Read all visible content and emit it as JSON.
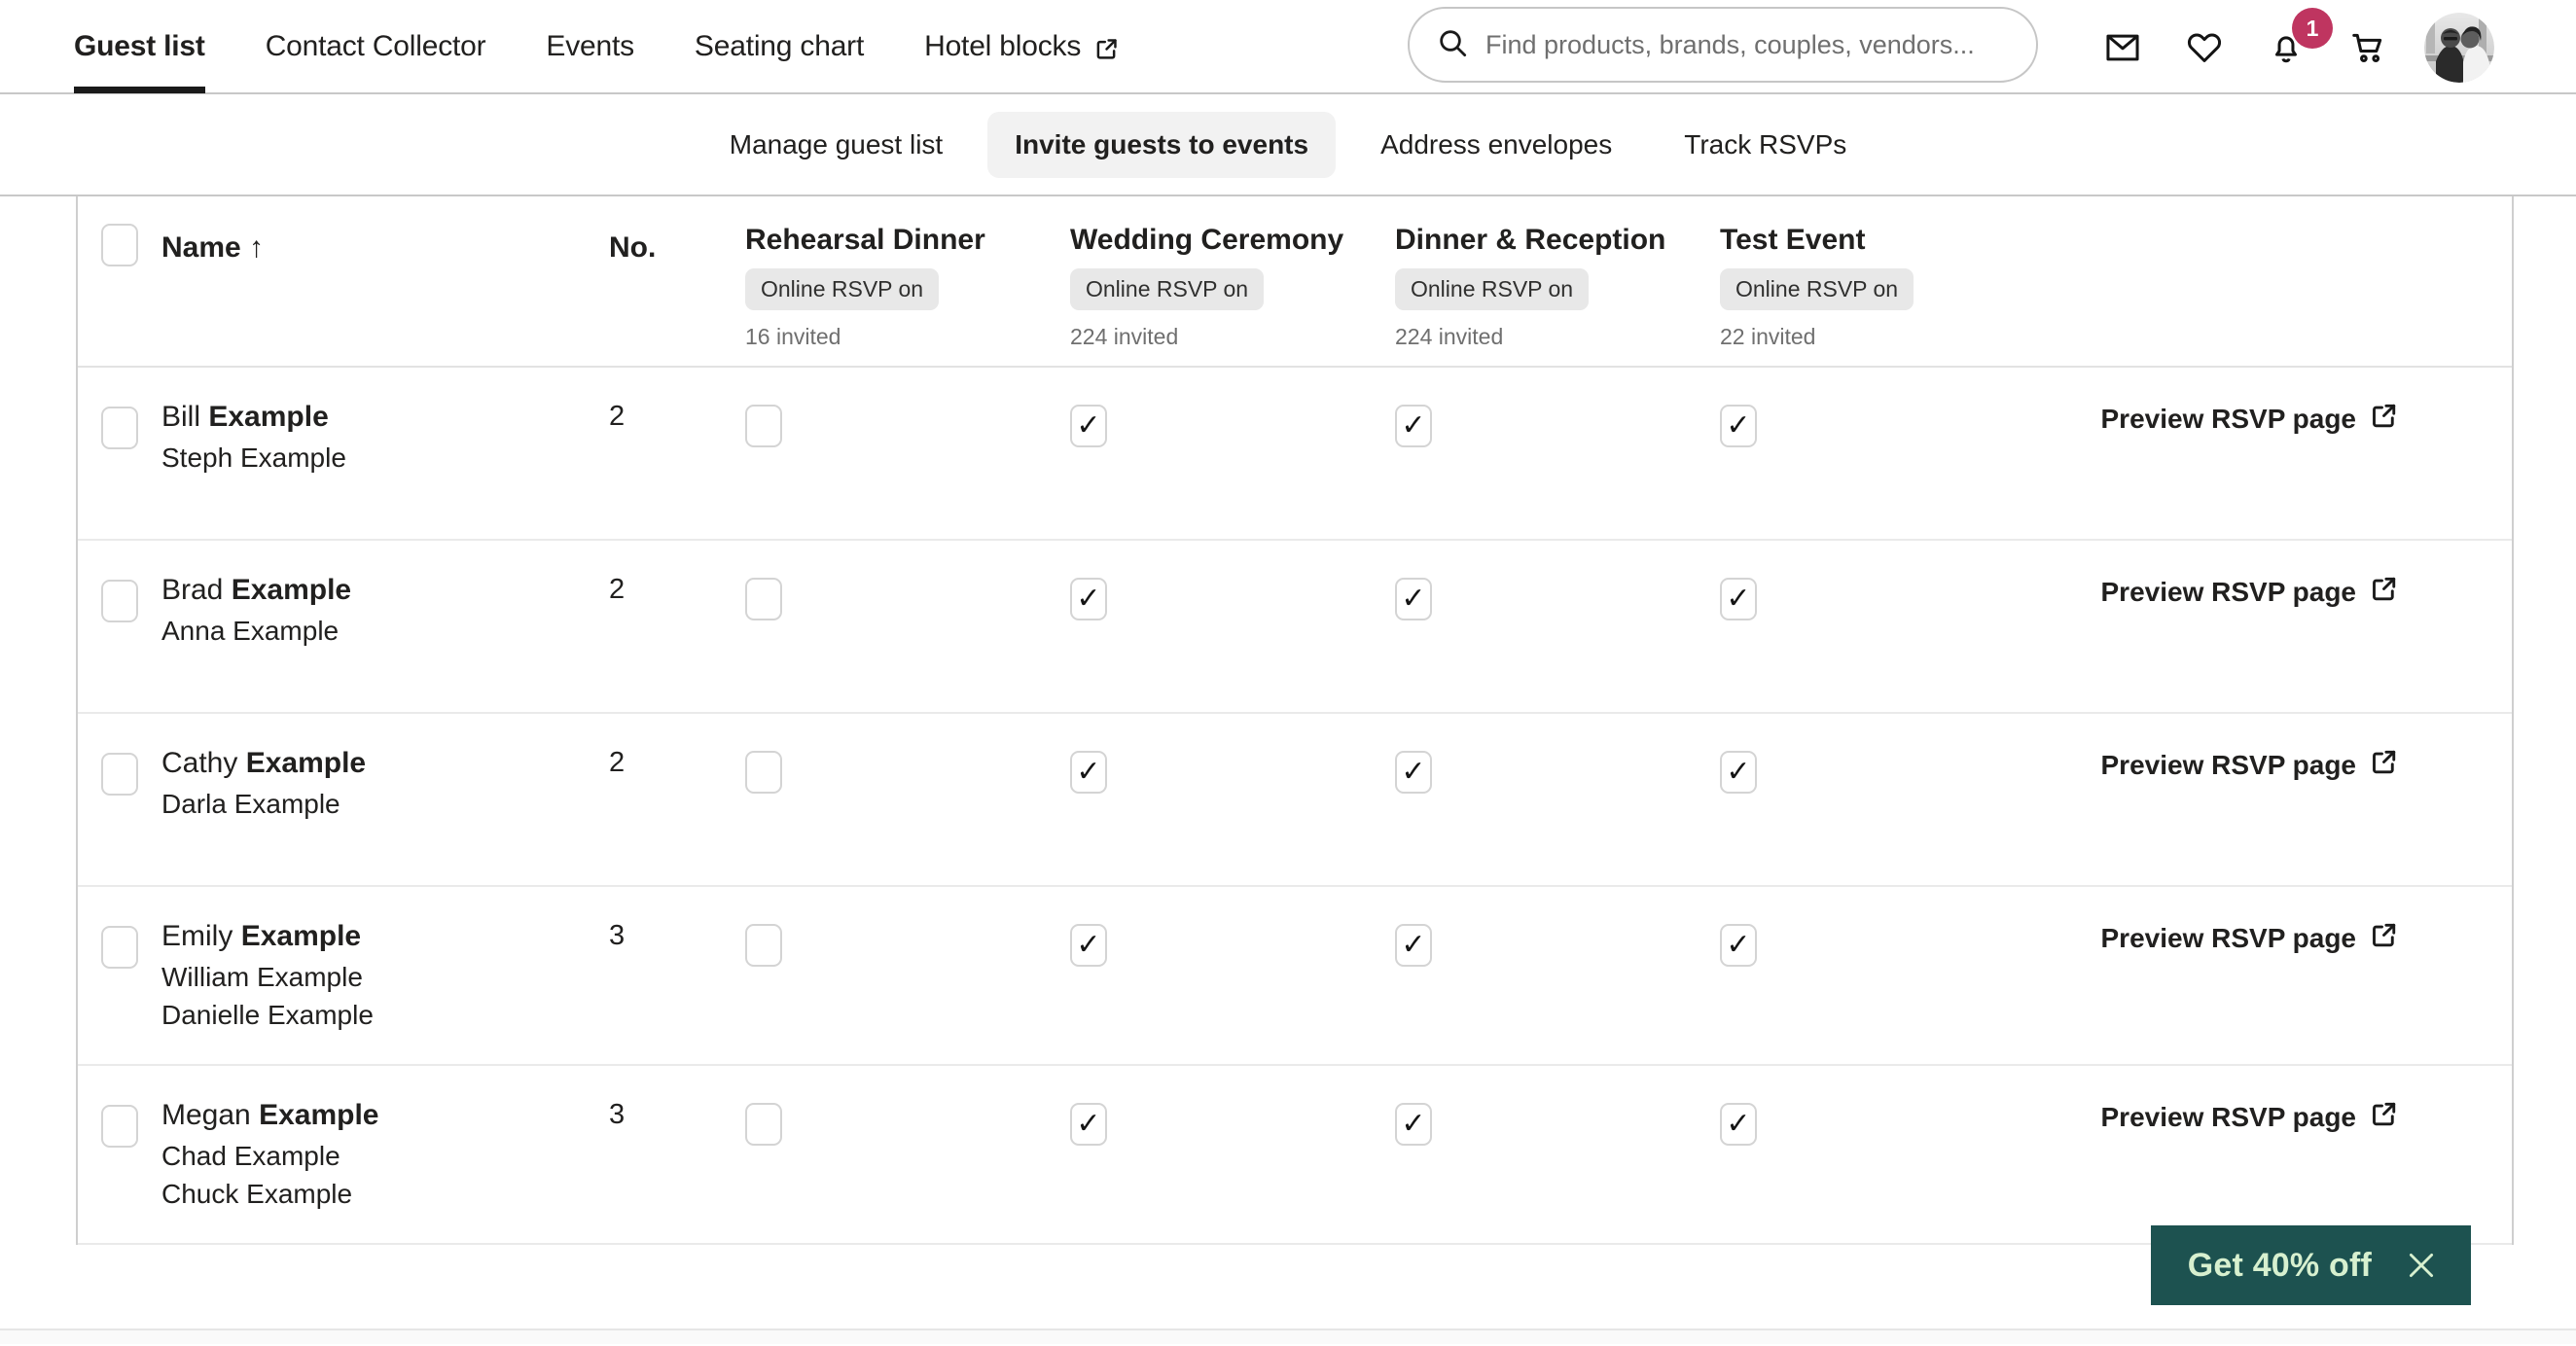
{
  "topnav": {
    "items": [
      {
        "label": "Guest list",
        "active": true,
        "external": false
      },
      {
        "label": "Contact Collector",
        "active": false,
        "external": false
      },
      {
        "label": "Events",
        "active": false,
        "external": false
      },
      {
        "label": "Seating chart",
        "active": false,
        "external": false
      },
      {
        "label": "Hotel blocks",
        "active": false,
        "external": true
      }
    ],
    "search": {
      "value": "",
      "placeholder": "Find products, brands, couples, vendors..."
    },
    "icons": [
      {
        "name": "mail-icon",
        "badge": null
      },
      {
        "name": "heart-icon",
        "badge": null
      },
      {
        "name": "bell-icon",
        "badge": "1"
      },
      {
        "name": "cart-icon",
        "badge": null
      }
    ],
    "badge_color": "#bf3560",
    "avatar_alt": "couple photo"
  },
  "subnav": {
    "items": [
      {
        "label": "Manage guest list",
        "active": false
      },
      {
        "label": "Invite guests to events",
        "active": true
      },
      {
        "label": "Address envelopes",
        "active": false
      },
      {
        "label": "Track RSVPs",
        "active": false
      }
    ]
  },
  "table": {
    "headers": {
      "name": "Name ↑",
      "no": "No.",
      "preview": ""
    },
    "events": [
      {
        "title": "Rehearsal Dinner",
        "rsvp_pill": "Online RSVP on",
        "invited": "16 invited"
      },
      {
        "title": "Wedding Ceremony",
        "rsvp_pill": "Online RSVP on",
        "invited": "224 invited"
      },
      {
        "title": "Dinner & Reception",
        "rsvp_pill": "Online RSVP on",
        "invited": "224 invited"
      },
      {
        "title": "Test Event",
        "rsvp_pill": "Online RSVP on",
        "invited": "22 invited"
      }
    ],
    "preview_label": "Preview RSVP page",
    "rows": [
      {
        "selected": false,
        "first_name": "Bill",
        "last_name": "Example",
        "extra": [
          "Steph Example"
        ],
        "no": "2",
        "checks": [
          false,
          true,
          true,
          true
        ],
        "preview": "Preview RSVP page"
      },
      {
        "selected": false,
        "first_name": "Brad",
        "last_name": "Example",
        "extra": [
          "Anna Example"
        ],
        "no": "2",
        "checks": [
          false,
          true,
          true,
          true
        ],
        "preview": "Preview RSVP page"
      },
      {
        "selected": false,
        "first_name": "Cathy",
        "last_name": "Example",
        "extra": [
          "Darla Example"
        ],
        "no": "2",
        "checks": [
          false,
          true,
          true,
          true
        ],
        "preview": "Preview RSVP page"
      },
      {
        "selected": false,
        "first_name": "Emily",
        "last_name": "Example",
        "extra": [
          "William Example",
          "Danielle Example"
        ],
        "no": "3",
        "checks": [
          false,
          true,
          true,
          true
        ],
        "preview": "Preview RSVP page"
      },
      {
        "selected": false,
        "first_name": "Megan",
        "last_name": "Example",
        "extra": [
          "Chad Example",
          "Chuck Example"
        ],
        "no": "3",
        "checks": [
          false,
          true,
          true,
          true
        ],
        "preview": "Preview RSVP page"
      }
    ]
  },
  "promo": {
    "label": "Get 40% off",
    "bg_color": "#1d5250",
    "text_color": "#d7f0cf"
  }
}
